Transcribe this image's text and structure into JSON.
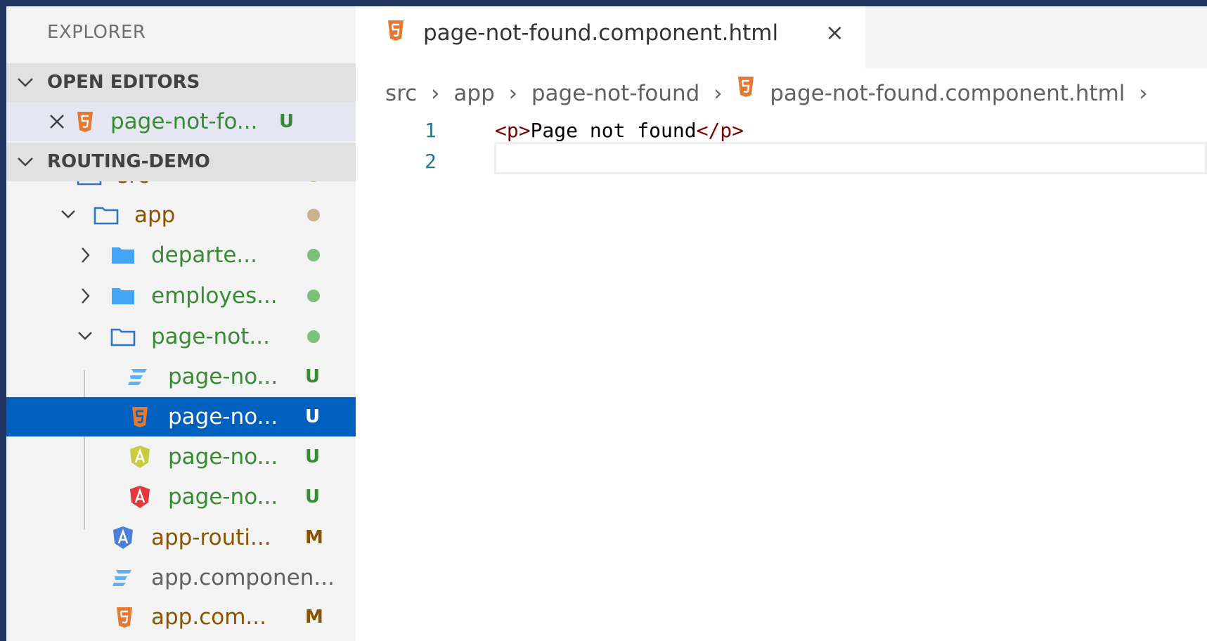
{
  "sidebar": {
    "title": "EXPLORER",
    "sections": {
      "open_editors": "OPEN EDITORS",
      "project": "ROUTING-DEMO"
    },
    "open_editors": [
      {
        "label": "page-not-fo...",
        "badge": "U"
      }
    ],
    "tree": [
      {
        "label": "src",
        "badge": ""
      },
      {
        "label": "app",
        "badge": ""
      },
      {
        "label": "departe...",
        "badge": ""
      },
      {
        "label": "employes...",
        "badge": ""
      },
      {
        "label": "page-not...",
        "badge": ""
      },
      {
        "label": "page-no...",
        "badge": "U"
      },
      {
        "label": "page-no...",
        "badge": "U"
      },
      {
        "label": "page-no...",
        "badge": "U"
      },
      {
        "label": "page-no...",
        "badge": "U"
      },
      {
        "label": "app-routi...",
        "badge": "M"
      },
      {
        "label": "app.componen...",
        "badge": ""
      },
      {
        "label": "app.com...",
        "badge": "M"
      }
    ]
  },
  "editor": {
    "tab": {
      "label": "page-not-found.component.html",
      "close": "×"
    },
    "breadcrumb": [
      "src",
      "app",
      "page-not-found",
      "page-not-found.component.html"
    ],
    "lines": [
      {
        "num": "1",
        "open_tag": "<p>",
        "text": "Page not found",
        "close_tag": "</p>"
      },
      {
        "num": "2",
        "open_tag": "",
        "text": "",
        "close_tag": ""
      }
    ]
  },
  "colors": {
    "selection": "#0060c0",
    "untracked": "#388a34",
    "modified": "#895503",
    "html_icon": "#e37933",
    "angular_yellow": "#cbcb41",
    "angular_red": "#e03a3e",
    "angular_blue": "#4d7fd8",
    "folder_blue": "#42a5f5"
  },
  "icons": [
    "chevron-down-icon",
    "chevron-right-icon",
    "close-icon",
    "html-file-icon",
    "css-file-icon",
    "angular-spec-icon",
    "angular-component-icon",
    "angular-routing-icon",
    "folder-icon",
    "folder-open-icon",
    "git-status-dot-icon"
  ]
}
